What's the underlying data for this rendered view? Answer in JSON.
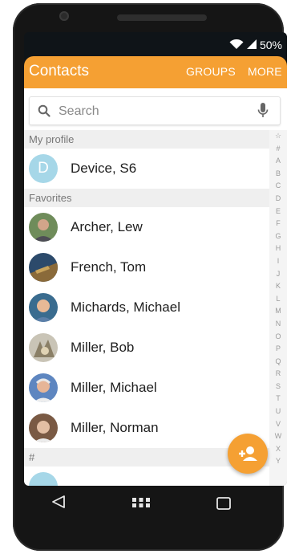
{
  "status": {
    "battery": "50%",
    "icons": [
      "wifi-icon",
      "signal-icon"
    ]
  },
  "appbar": {
    "title": "Contacts",
    "tab_groups": "GROUPS",
    "tab_more": "MORE",
    "color": "#f5a033"
  },
  "search": {
    "placeholder": "Search"
  },
  "sections": {
    "my_profile": "My profile",
    "favorites": "Favorites",
    "hash": "#"
  },
  "profile": {
    "initial": "D",
    "name": "Device, S6"
  },
  "favorites": [
    {
      "name": "Archer, Lew",
      "avatar": "photo"
    },
    {
      "name": "French, Tom",
      "avatar": "photo"
    },
    {
      "name": "Michards, Michael",
      "avatar": "photo"
    },
    {
      "name": "Miller, Bob",
      "avatar": "photo"
    },
    {
      "name": "Miller, Michael",
      "avatar": "photo"
    },
    {
      "name": "Miller, Norman",
      "avatar": "photo"
    }
  ],
  "index": [
    "☆",
    "#",
    "A",
    "B",
    "C",
    "D",
    "E",
    "F",
    "G",
    "H",
    "I",
    "J",
    "K",
    "L",
    "M",
    "N",
    "O",
    "P",
    "Q",
    "R",
    "S",
    "T",
    "U",
    "V",
    "W",
    "X",
    "Y"
  ],
  "fab": {
    "icon": "add-contact-icon"
  },
  "navbar": {
    "icons": [
      "back-icon",
      "home-icon",
      "recent-apps-icon"
    ]
  }
}
